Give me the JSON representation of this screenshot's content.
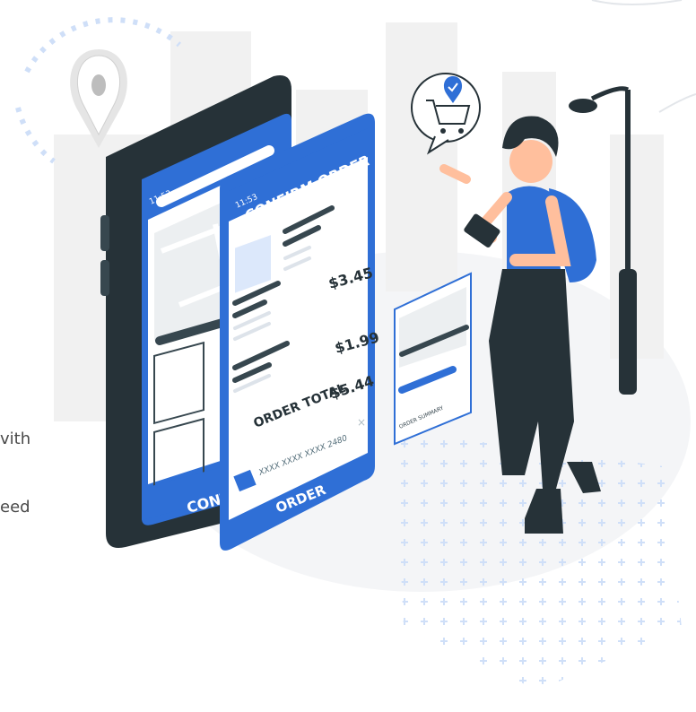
{
  "left_text": {
    "line_1": "vith",
    "line_2": "eed"
  },
  "phone_back": {
    "time": "11:53",
    "button_label": "CONT"
  },
  "phone_front": {
    "time": "11:53",
    "title": "CONFIRM ORDER",
    "price_1": "$3.45",
    "price_2": "$1.99",
    "total_label": "ORDER TOTAL",
    "total_value": "$5.44",
    "card_number": "XXXX XXXX XXXX 2480",
    "order_button": "ORDER"
  },
  "summary_card": {
    "label": "ORDER SUMMARY"
  },
  "colors": {
    "accent": "#2f6fd6",
    "dark": "#263238",
    "light_blue": "#dce8fb"
  }
}
